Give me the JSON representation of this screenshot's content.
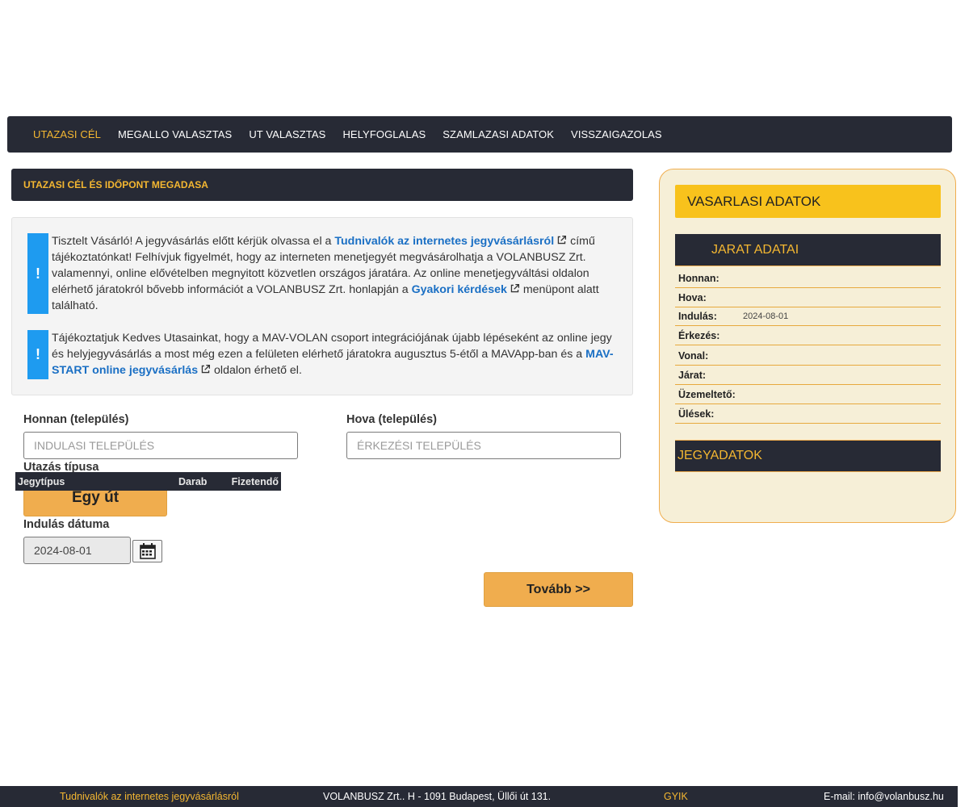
{
  "nav": {
    "items": [
      {
        "label": "UTAZASI CÉL"
      },
      {
        "label": "MEGALLO VALASZTAS"
      },
      {
        "label": "UT VALASZTAS"
      },
      {
        "label": "HELYFOGLALAS"
      },
      {
        "label": "SZAMLAZASI ADATOK"
      },
      {
        "label": "VISSZAIGAZOLAS"
      }
    ]
  },
  "main": {
    "section_title": "UTAZASI CÉL ÉS IDŐPONT MEGADASA",
    "notice1": {
      "icon": "!",
      "text_a": "Tisztelt Vásárló! A jegyvásárlás előtt kérjük olvassa el a ",
      "link1": "Tudnivalók az internetes jegyvásárlásról",
      "text_b": " című tájékoztatónkat! Felhívjuk figyelmét, hogy az interneten menetjegyét megvásárolhatja a VOLANBUSZ Zrt. valamennyi, online elővételben megnyitott közvetlen országos járatára. Az online menetjegyváltási oldalon elérhető járatokról bővebb információt a VOLANBUSZ Zrt. honlapján a ",
      "link2": "Gyakori kérdések",
      "text_c": " menüpont alatt található."
    },
    "notice2": {
      "icon": "!",
      "text_a": "Tájékoztatjuk Kedves Utasainkat, hogy a MAV-VOLAN csoport integrációjának újabb lépéseként az online jegy és helyjegyvásárlás a most még ezen a felületen elérhető járatokra augusztus 5-étől a MAVApp-ban és a ",
      "link": "MAV-START online jegyvásárlás",
      "text_b": " oldalon érhető el."
    },
    "from_label": "Honnan (település)",
    "from_placeholder": "INDULASI TELEPÜLÉS",
    "to_label": "Hova (település)",
    "to_placeholder": "ÉRKEZÉSI TELEPÜLÉS",
    "trip_type_label": "Utazás típusa",
    "trip_type_button": "Egy út",
    "date_label": "Indulás dátuma",
    "date_value": "2024-08-01",
    "next_button": "Tovább >>"
  },
  "sidebar": {
    "title": "VASARLASI ADATOK",
    "journey_title": "JARAT ADATAI",
    "rows": [
      {
        "key": "Honnan:",
        "value": ""
      },
      {
        "key": "Hova:",
        "value": ""
      },
      {
        "key": "Indulás:",
        "value": "2024-08-01"
      },
      {
        "key": "Érkezés:",
        "value": ""
      },
      {
        "key": "Vonal:",
        "value": ""
      },
      {
        "key": "Járat:",
        "value": ""
      },
      {
        "key": "Üzemeltető:",
        "value": ""
      },
      {
        "key": "Ülések:",
        "value": ""
      }
    ],
    "ticket_title": "JEGYADATOK",
    "ticket_columns": {
      "type": "Jegytípus",
      "count": "Darab",
      "pay": "Fizetendő"
    }
  },
  "footer": {
    "info_link": "Tudnivalók az internetes jegyvásárlásról",
    "address": "VOLANBUSZ Zrt.. H - 1091 Budapest, Üllői út 131.",
    "faq_link": "GYIK",
    "email": "E-mail: info@volanbusz.hu"
  },
  "colors": {
    "dark": "#272a35",
    "accent": "#f4b731",
    "button": "#f0ad4e",
    "notice": "#1e9bf0",
    "sidebar_bg": "#f6efd7"
  }
}
